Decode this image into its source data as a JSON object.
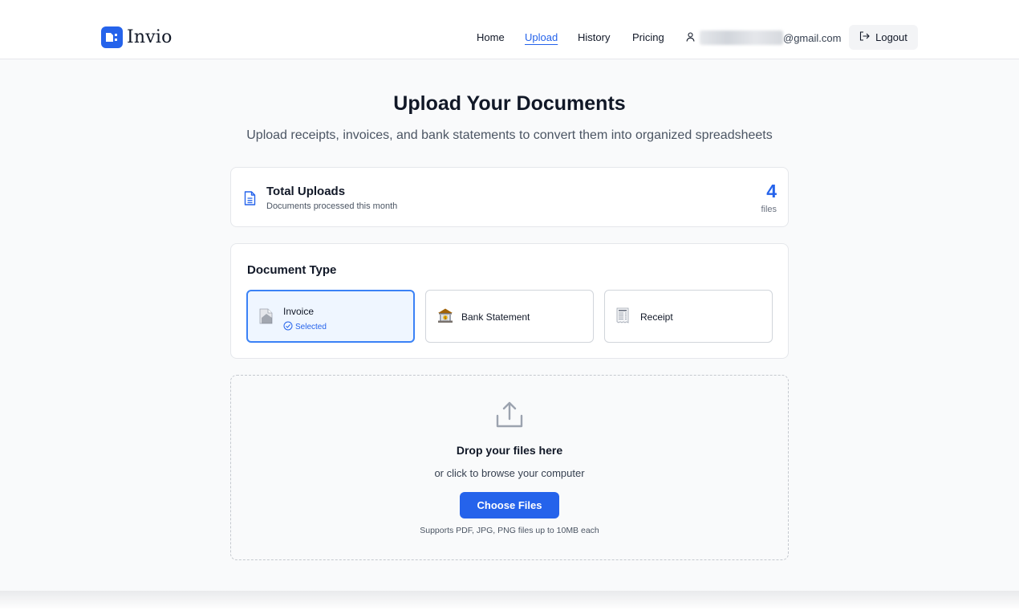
{
  "brand": {
    "name": "Invio"
  },
  "nav": {
    "items": [
      {
        "label": "Home",
        "active": false
      },
      {
        "label": "Upload",
        "active": true
      },
      {
        "label": "History",
        "active": false
      },
      {
        "label": "Pricing",
        "active": false
      }
    ]
  },
  "user": {
    "email_visible": "@gmail.com",
    "icon": "user-icon"
  },
  "logout": {
    "label": "Logout",
    "icon": "logout-icon"
  },
  "page": {
    "title": "Upload Your Documents",
    "subtitle": "Upload receipts, invoices, and bank statements to convert them into organized spreadsheets"
  },
  "stats": {
    "title": "Total Uploads",
    "description": "Documents processed this month",
    "count": "4",
    "unit": "files",
    "icon": "document-icon"
  },
  "document_type": {
    "title": "Document Type",
    "options": [
      {
        "label": "Invoice",
        "status": "Selected",
        "selected": true,
        "icon": "invoice-icon"
      },
      {
        "label": "Bank Statement",
        "selected": false,
        "icon": "bank-icon"
      },
      {
        "label": "Receipt",
        "selected": false,
        "icon": "receipt-icon"
      }
    ]
  },
  "dropzone": {
    "icon": "upload-icon",
    "title": "Drop your files here",
    "subtitle": "or click to browse your computer",
    "button_label": "Choose Files",
    "note": "Supports PDF, JPG, PNG files up to 10MB each"
  },
  "colors": {
    "accent": "#2563eb",
    "selected_bg": "#eff6ff",
    "page_bg": "#f9fafb"
  }
}
